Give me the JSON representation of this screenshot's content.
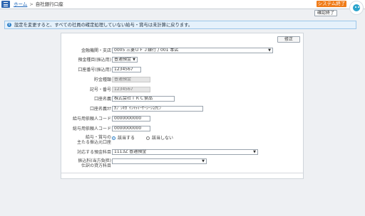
{
  "breadcrumb": {
    "home": "ホーム",
    "separator": ">",
    "current": "自社銀行口座"
  },
  "header": {
    "system_exit": "システム終了",
    "confirm_exit": "確認終了"
  },
  "notice": {
    "message": "設定を変更すると、すべての社員の確定処理していない給与・賞与は未計算に戻ります。"
  },
  "form": {
    "edit_button": "修正",
    "bank_branch": {
      "label": "金融機関・支店",
      "value": "0005 三菱ＵＦＪ銀行 / 001 本店"
    },
    "deposit_type": {
      "label": "預金種目(振込用)",
      "value": "普通預金"
    },
    "account_no": {
      "label": "口座番号(振込用)",
      "value": "1234567"
    },
    "savings_type": {
      "label": "貯金種類",
      "value": "普通預金"
    },
    "symbol_no": {
      "label": "記号・番号",
      "value": "1234567"
    },
    "account_name": {
      "label": "口座名義",
      "value": "株式会社ＴＫＣ食品"
    },
    "account_name_kana": {
      "label": "口座名義ｶﾅ",
      "value": "ｶﾌﾞｼｷｶﾞｲｼｬﾃｨｰｹｰｼｰｼｮｸﾋﾝ"
    },
    "salary_client_code": {
      "label": "給与用依頼人コード",
      "value": "0000000000"
    },
    "bonus_client_code": {
      "label": "総与用依頼人コード",
      "value": "0000000000"
    },
    "main_account": {
      "label_line1": "給与・賞与の",
      "label_line2": "主たる振込元口座",
      "option_yes": "該当する",
      "option_no": "該当しない",
      "selected": "該当する"
    },
    "deposit_item": {
      "label": "対応する預金科目",
      "value": "1113Z 普通預金"
    },
    "transfer_fee": {
      "label_line1": "振込料(当方負担)",
      "label_line2": "仕訳の貸方科目",
      "value": ""
    }
  }
}
